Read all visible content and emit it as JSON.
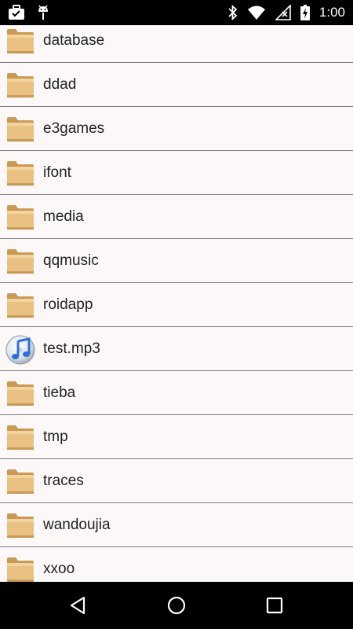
{
  "status_bar": {
    "left_icons": [
      "briefcase-icon",
      "android-debug-icon"
    ],
    "right_icons": [
      "bluetooth-icon",
      "wifi-icon",
      "no-signal-icon",
      "battery-charging-icon"
    ],
    "time": "1:00"
  },
  "file_list": {
    "items": [
      {
        "name": "database",
        "icon": "folder-icon"
      },
      {
        "name": "ddad",
        "icon": "folder-icon"
      },
      {
        "name": "e3games",
        "icon": "folder-icon"
      },
      {
        "name": "ifont",
        "icon": "folder-icon"
      },
      {
        "name": "media",
        "icon": "folder-icon"
      },
      {
        "name": "qqmusic",
        "icon": "folder-icon"
      },
      {
        "name": "roidapp",
        "icon": "folder-icon"
      },
      {
        "name": "test.mp3",
        "icon": "music-file-icon"
      },
      {
        "name": "tieba",
        "icon": "folder-icon"
      },
      {
        "name": "tmp",
        "icon": "folder-icon"
      },
      {
        "name": "traces",
        "icon": "folder-icon"
      },
      {
        "name": "wandoujia",
        "icon": "folder-icon"
      },
      {
        "name": "xxoo",
        "icon": "folder-icon"
      }
    ]
  },
  "nav_bar": {
    "buttons": [
      "back-icon",
      "home-icon",
      "recents-icon"
    ]
  },
  "colors": {
    "list_background": "#fcf8f8",
    "divider": "#7a7a7a",
    "bar_background": "#000000",
    "folder_light": "#ecc787",
    "folder_dark": "#c99a55",
    "music_blue": "#2c6fd6"
  }
}
